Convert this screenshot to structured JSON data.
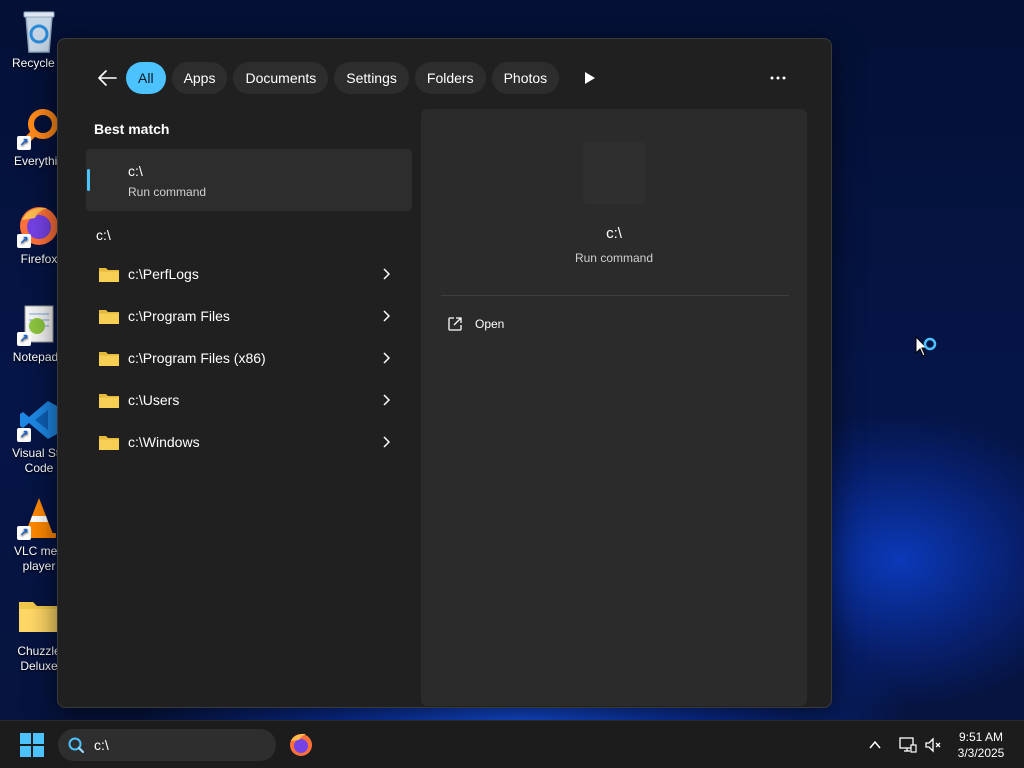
{
  "desktop": {
    "icons": [
      {
        "label": "Recycle B"
      },
      {
        "label": "Everythin"
      },
      {
        "label": "Firefox"
      },
      {
        "label": "Notepad+"
      },
      {
        "label": "Visual Stu\nCode"
      },
      {
        "label": "VLC med\nplayer"
      },
      {
        "label": "Chuzzle\nDeluxe"
      }
    ]
  },
  "search_panel": {
    "filters": [
      "All",
      "Apps",
      "Documents",
      "Settings",
      "Folders",
      "Photos"
    ],
    "active_filter": "All",
    "best_match": {
      "section_title": "Best match",
      "name": "c:\\",
      "subtitle": "Run command"
    },
    "folders_group": {
      "title": "c:\\",
      "items": [
        {
          "label": "c:\\PerfLogs"
        },
        {
          "label": "c:\\Program Files"
        },
        {
          "label": "c:\\Program Files (x86)"
        },
        {
          "label": "c:\\Users"
        },
        {
          "label": "c:\\Windows"
        }
      ]
    },
    "preview": {
      "name": "c:\\",
      "subtitle": "Run command",
      "actions": [
        {
          "label": "Open",
          "icon": "open-external-icon"
        }
      ]
    }
  },
  "taskbar": {
    "search_value": "c:\\",
    "time": "9:51 AM",
    "date": "3/3/2025"
  },
  "colors": {
    "accent": "#4cc2ff",
    "panel_bg": "#202020",
    "preview_bg": "#2b2b2b",
    "folder_yellow": "#f2c94c"
  }
}
